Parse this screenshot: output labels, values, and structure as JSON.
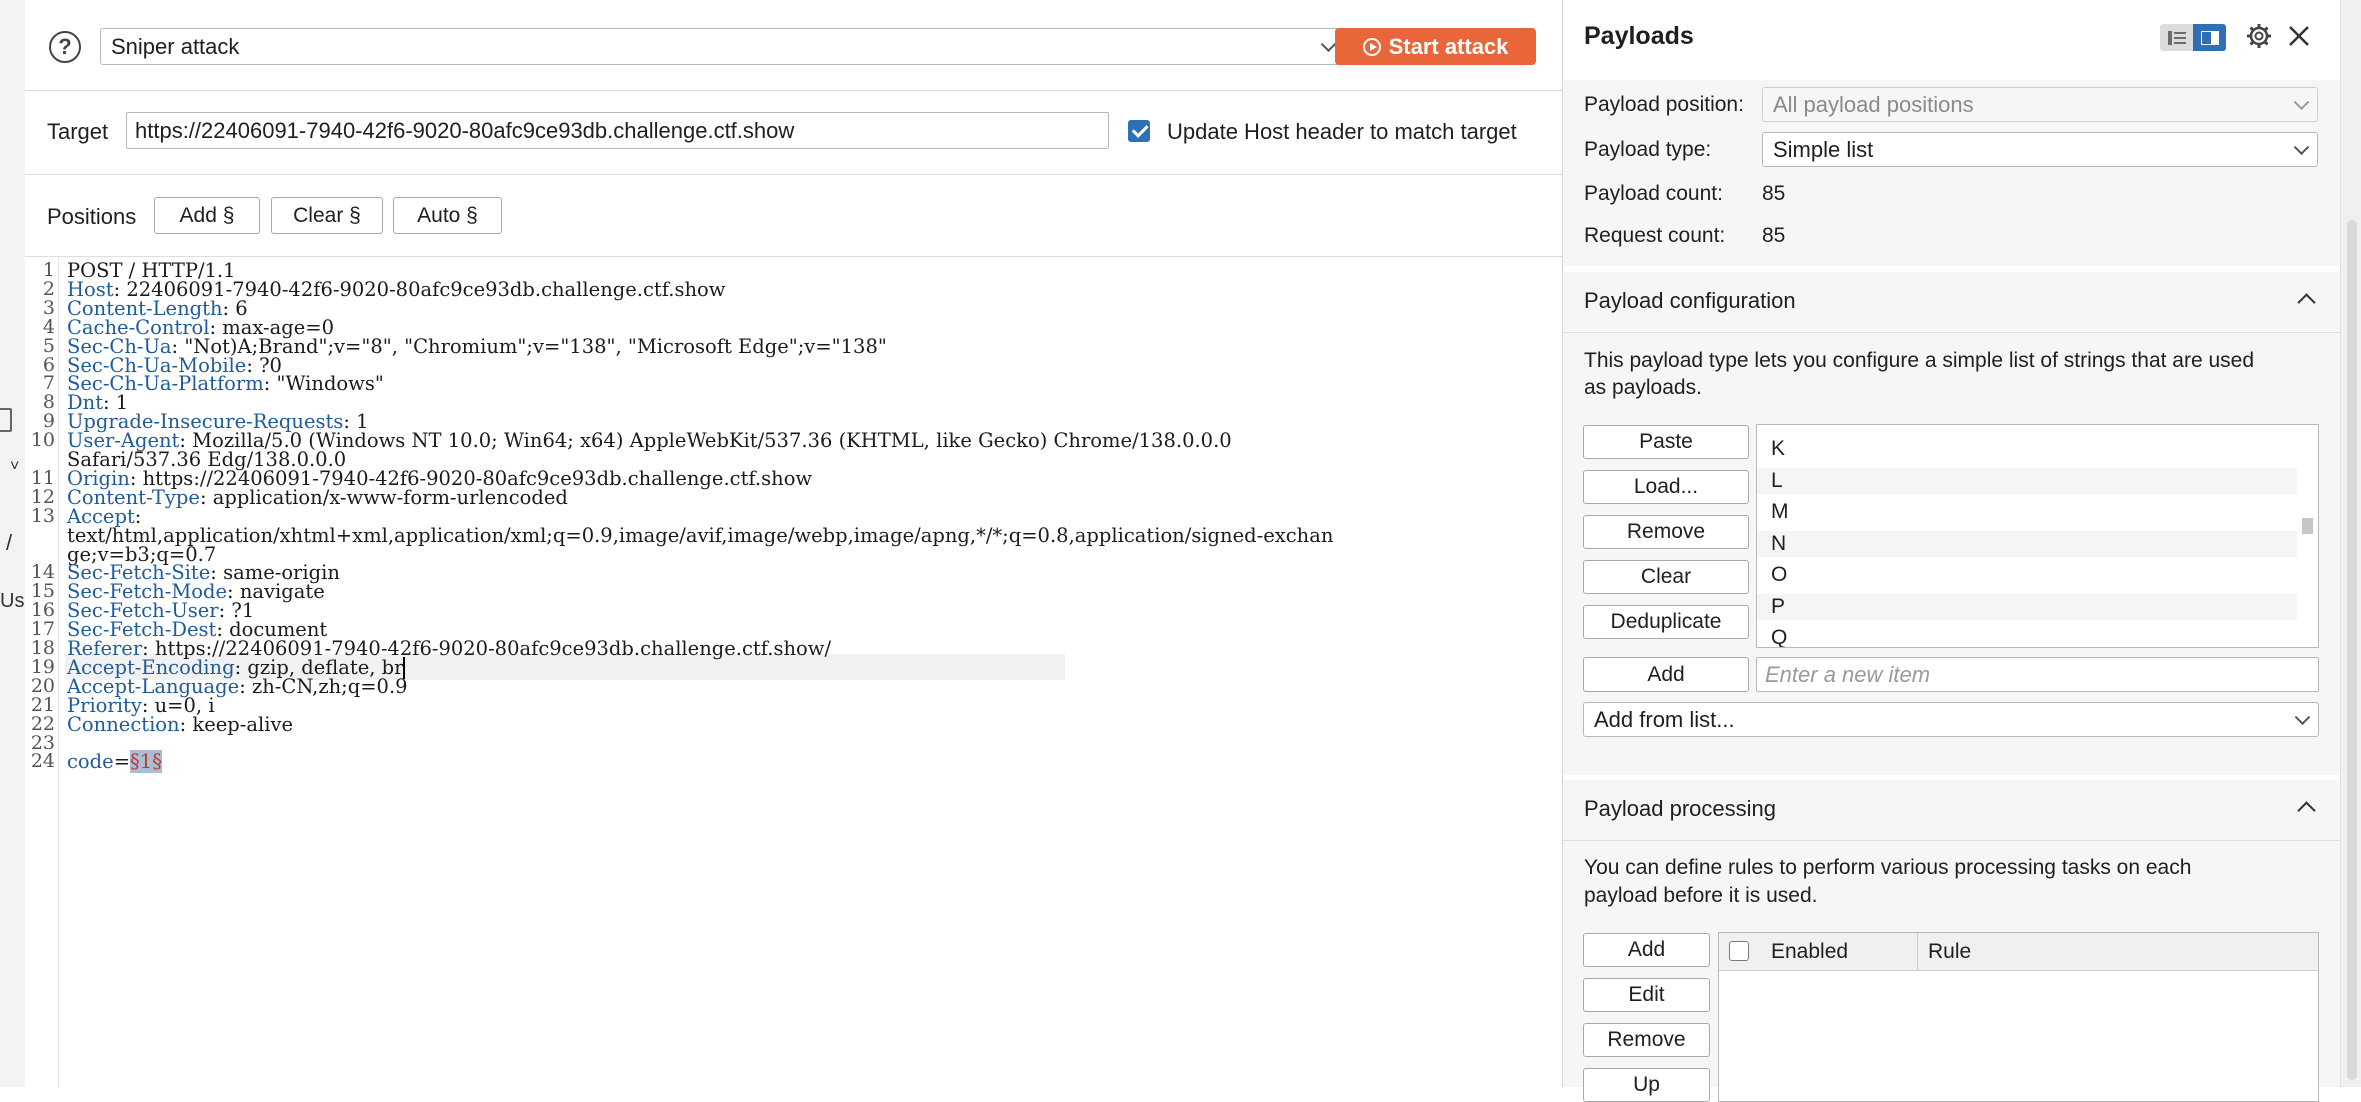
{
  "attack": {
    "help_icon": "question-circle-icon",
    "type_value": "Sniper attack",
    "start_label": "Start attack"
  },
  "target": {
    "label": "Target",
    "url": "https://22406091-7940-42f6-9020-80afc9ce93db.challenge.ctf.show",
    "update_host_checked": true,
    "update_host_label": "Update Host header to match target"
  },
  "positions": {
    "label": "Positions",
    "add_label": "Add §",
    "clear_label": "Clear §",
    "auto_label": "Auto §"
  },
  "editor": {
    "lines": [
      {
        "n": "1",
        "key": "",
        "val": "POST / HTTP/1.1"
      },
      {
        "n": "2",
        "key": "Host",
        "val": ": 22406091-7940-42f6-9020-80afc9ce93db.challenge.ctf.show"
      },
      {
        "n": "3",
        "key": "Content-Length",
        "val": ": 6"
      },
      {
        "n": "4",
        "key": "Cache-Control",
        "val": ": max-age=0"
      },
      {
        "n": "5",
        "key": "Sec-Ch-Ua",
        "val": ": \"Not)A;Brand\";v=\"8\", \"Chromium\";v=\"138\", \"Microsoft Edge\";v=\"138\""
      },
      {
        "n": "6",
        "key": "Sec-Ch-Ua-Mobile",
        "val": ": ?0"
      },
      {
        "n": "7",
        "key": "Sec-Ch-Ua-Platform",
        "val": ": \"Windows\""
      },
      {
        "n": "8",
        "key": "Dnt",
        "val": ": 1"
      },
      {
        "n": "9",
        "key": "Upgrade-Insecure-Requests",
        "val": ": 1"
      },
      {
        "n": "10",
        "key": "User-Agent",
        "val": ": Mozilla/5.0 (Windows NT 10.0; Win64; x64) AppleWebKit/537.36 (KHTML, like Gecko) Chrome/138.0.0.0"
      },
      {
        "n": "",
        "key": "",
        "val": "Safari/537.36 Edg/138.0.0.0"
      },
      {
        "n": "11",
        "key": "Origin",
        "val": ": https://22406091-7940-42f6-9020-80afc9ce93db.challenge.ctf.show"
      },
      {
        "n": "12",
        "key": "Content-Type",
        "val": ": application/x-www-form-urlencoded"
      },
      {
        "n": "13",
        "key": "Accept",
        "val": ":"
      },
      {
        "n": "",
        "key": "",
        "val": "text/html,application/xhtml+xml,application/xml;q=0.9,image/avif,image/webp,image/apng,*/*;q=0.8,application/signed-exchan"
      },
      {
        "n": "",
        "key": "",
        "val": "ge;v=b3;q=0.7"
      },
      {
        "n": "14",
        "key": "Sec-Fetch-Site",
        "val": ": same-origin"
      },
      {
        "n": "15",
        "key": "Sec-Fetch-Mode",
        "val": ": navigate"
      },
      {
        "n": "16",
        "key": "Sec-Fetch-User",
        "val": ": ?1"
      },
      {
        "n": "17",
        "key": "Sec-Fetch-Dest",
        "val": ": document"
      },
      {
        "n": "18",
        "key": "Referer",
        "val": ": https://22406091-7940-42f6-9020-80afc9ce93db.challenge.ctf.show/"
      },
      {
        "n": "19",
        "key": "Accept-Encoding",
        "val": ": gzip, deflate, br",
        "caret": true
      },
      {
        "n": "20",
        "key": "Accept-Language",
        "val": ": zh-CN,zh;q=0.9"
      },
      {
        "n": "21",
        "key": "Priority",
        "val": ": u=0, i"
      },
      {
        "n": "22",
        "key": "Connection",
        "val": ": keep-alive"
      },
      {
        "n": "23",
        "key": "",
        "val": ""
      },
      {
        "n": "24",
        "key": "code",
        "val": "=",
        "marker": "§1§"
      }
    ]
  },
  "payloads": {
    "title": "Payloads",
    "position_label": "Payload position:",
    "position_value": "All payload positions",
    "type_label": "Payload type:",
    "type_value": "Simple list",
    "count_label": "Payload count:",
    "count_value": "85",
    "request_label": "Request count:",
    "request_value": "85",
    "config": {
      "title": "Payload configuration",
      "description_1": "This payload type lets you configure a simple list of strings that are used",
      "description_2": "as payloads.",
      "paste": "Paste",
      "load": "Load...",
      "remove": "Remove",
      "clear": "Clear",
      "dedup": "Deduplicate",
      "add": "Add",
      "new_item_placeholder": "Enter a new item",
      "add_from_list": "Add from list...",
      "items": [
        "K",
        "L",
        "M",
        "N",
        "O",
        "P",
        "Q"
      ]
    },
    "processing": {
      "title": "Payload processing",
      "description_1": "You can define rules to perform various processing tasks on each",
      "description_2": "payload before it is used.",
      "add": "Add",
      "edit": "Edit",
      "remove": "Remove",
      "up": "Up",
      "col_enabled": "Enabled",
      "col_rule": "Rule"
    }
  },
  "edge": {
    "fragment_1": "/",
    "fragment_2": "Us"
  },
  "colors": {
    "accent": "#e8663a",
    "header_key": "#1f5a9a",
    "checkbox": "#2f6fb5",
    "marker_bg": "#a9bdd6",
    "marker_fg": "#c0392b"
  }
}
